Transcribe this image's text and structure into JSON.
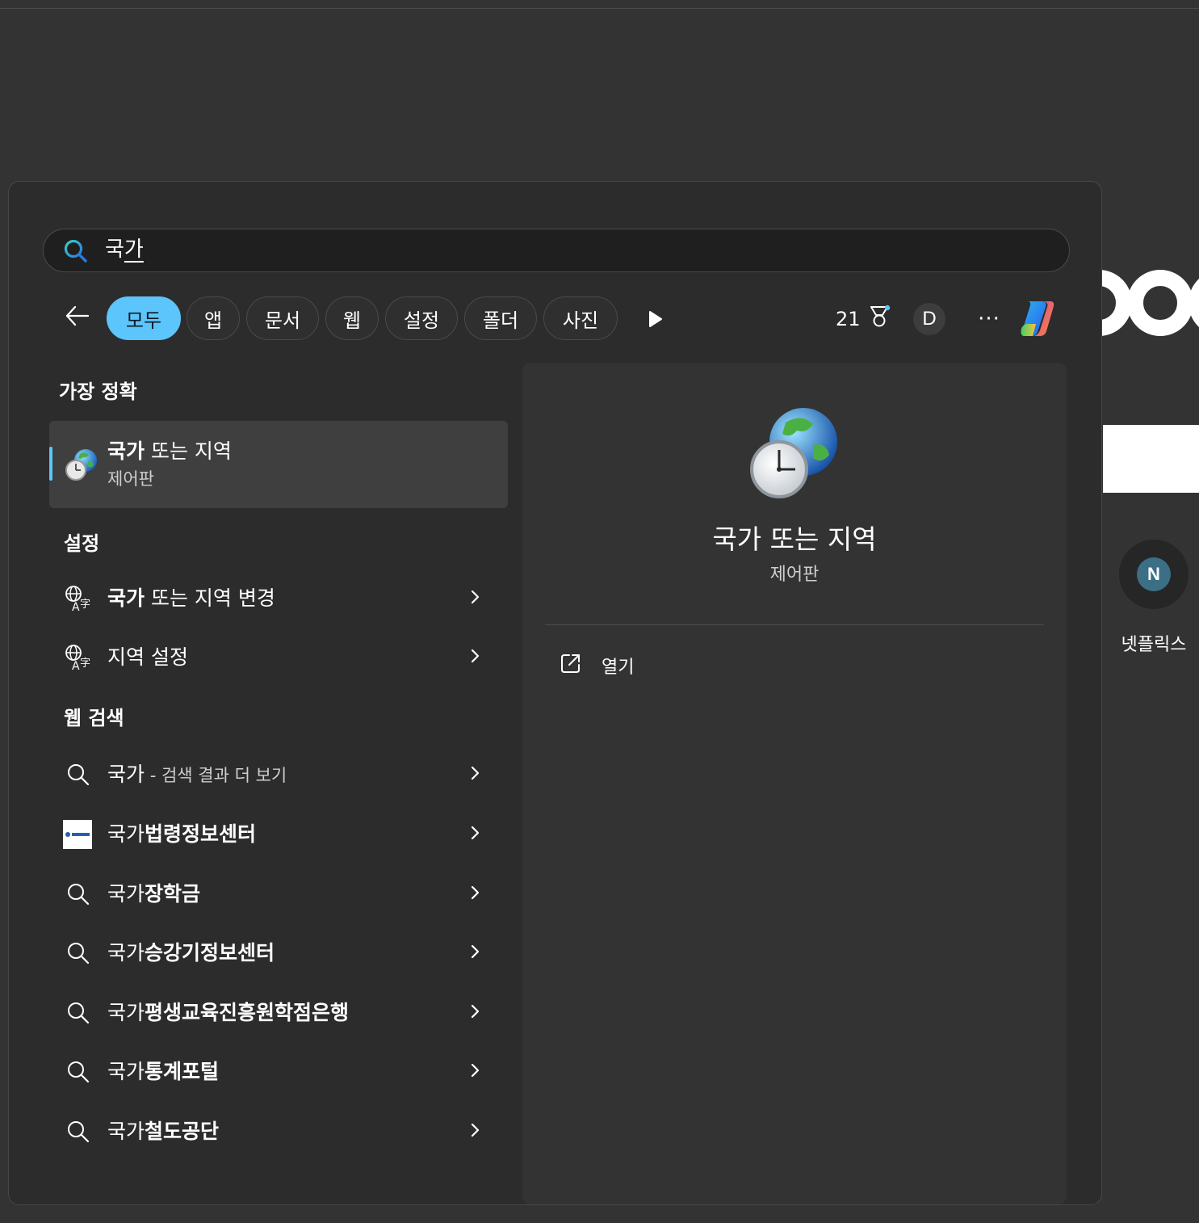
{
  "search": {
    "query_prefix": "국",
    "query_rest": "가"
  },
  "filters": [
    {
      "label": "모두",
      "active": true
    },
    {
      "label": "앱"
    },
    {
      "label": "문서"
    },
    {
      "label": "웹"
    },
    {
      "label": "설정"
    },
    {
      "label": "폴더"
    },
    {
      "label": "사진"
    }
  ],
  "toolbar": {
    "points": "21",
    "avatar_initial": "D",
    "more_label": "···"
  },
  "best_match": {
    "heading": "가장 정확",
    "title_bold": "국가",
    "title_rest": " 또는 지역",
    "subtitle": "제어판"
  },
  "settings": {
    "heading": "설정",
    "items": [
      {
        "bold": "국가",
        "rest": " 또는 지역 변경"
      },
      {
        "bold": "",
        "rest": "지역 설정"
      }
    ]
  },
  "web": {
    "heading": "웹 검색",
    "items": [
      {
        "plain": "국가",
        "sub": " - 검색 결과 더 보기",
        "bold": "",
        "icon": "search-icon"
      },
      {
        "plain": "국가",
        "sub": "",
        "bold": "법령정보센터",
        "icon": "site-favicon"
      },
      {
        "plain": "국가",
        "sub": "",
        "bold": "장학금",
        "icon": "search-icon"
      },
      {
        "plain": "국가",
        "sub": "",
        "bold": "승강기정보센터",
        "icon": "search-icon"
      },
      {
        "plain": "국가",
        "sub": "",
        "bold": "평생교육진흥원학점은행",
        "icon": "search-icon"
      },
      {
        "plain": "국가",
        "sub": "",
        "bold": "통계포털",
        "icon": "search-icon"
      },
      {
        "plain": "국가",
        "sub": "",
        "bold": "철도공단",
        "icon": "search-icon"
      }
    ]
  },
  "preview": {
    "title": "국가 또는 지역",
    "subtitle": "제어판",
    "open_label": "열기"
  },
  "background": {
    "tile_initial": "N",
    "tile_label": "넷플릭스"
  },
  "colors": {
    "accent": "#5cc5fb",
    "panel": "#2c2c2c",
    "preview": "#333333"
  }
}
